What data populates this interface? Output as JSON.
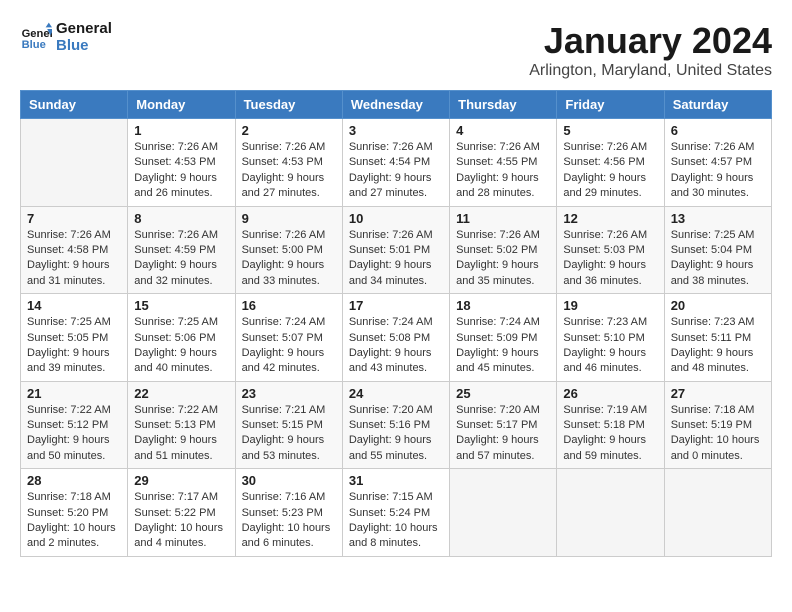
{
  "logo": {
    "line1": "General",
    "line2": "Blue"
  },
  "title": "January 2024",
  "subtitle": "Arlington, Maryland, United States",
  "headers": [
    "Sunday",
    "Monday",
    "Tuesday",
    "Wednesday",
    "Thursday",
    "Friday",
    "Saturday"
  ],
  "weeks": [
    [
      {
        "day": "",
        "info": ""
      },
      {
        "day": "1",
        "info": "Sunrise: 7:26 AM\nSunset: 4:53 PM\nDaylight: 9 hours\nand 26 minutes."
      },
      {
        "day": "2",
        "info": "Sunrise: 7:26 AM\nSunset: 4:53 PM\nDaylight: 9 hours\nand 27 minutes."
      },
      {
        "day": "3",
        "info": "Sunrise: 7:26 AM\nSunset: 4:54 PM\nDaylight: 9 hours\nand 27 minutes."
      },
      {
        "day": "4",
        "info": "Sunrise: 7:26 AM\nSunset: 4:55 PM\nDaylight: 9 hours\nand 28 minutes."
      },
      {
        "day": "5",
        "info": "Sunrise: 7:26 AM\nSunset: 4:56 PM\nDaylight: 9 hours\nand 29 minutes."
      },
      {
        "day": "6",
        "info": "Sunrise: 7:26 AM\nSunset: 4:57 PM\nDaylight: 9 hours\nand 30 minutes."
      }
    ],
    [
      {
        "day": "7",
        "info": "Sunrise: 7:26 AM\nSunset: 4:58 PM\nDaylight: 9 hours\nand 31 minutes."
      },
      {
        "day": "8",
        "info": "Sunrise: 7:26 AM\nSunset: 4:59 PM\nDaylight: 9 hours\nand 32 minutes."
      },
      {
        "day": "9",
        "info": "Sunrise: 7:26 AM\nSunset: 5:00 PM\nDaylight: 9 hours\nand 33 minutes."
      },
      {
        "day": "10",
        "info": "Sunrise: 7:26 AM\nSunset: 5:01 PM\nDaylight: 9 hours\nand 34 minutes."
      },
      {
        "day": "11",
        "info": "Sunrise: 7:26 AM\nSunset: 5:02 PM\nDaylight: 9 hours\nand 35 minutes."
      },
      {
        "day": "12",
        "info": "Sunrise: 7:26 AM\nSunset: 5:03 PM\nDaylight: 9 hours\nand 36 minutes."
      },
      {
        "day": "13",
        "info": "Sunrise: 7:25 AM\nSunset: 5:04 PM\nDaylight: 9 hours\nand 38 minutes."
      }
    ],
    [
      {
        "day": "14",
        "info": "Sunrise: 7:25 AM\nSunset: 5:05 PM\nDaylight: 9 hours\nand 39 minutes."
      },
      {
        "day": "15",
        "info": "Sunrise: 7:25 AM\nSunset: 5:06 PM\nDaylight: 9 hours\nand 40 minutes."
      },
      {
        "day": "16",
        "info": "Sunrise: 7:24 AM\nSunset: 5:07 PM\nDaylight: 9 hours\nand 42 minutes."
      },
      {
        "day": "17",
        "info": "Sunrise: 7:24 AM\nSunset: 5:08 PM\nDaylight: 9 hours\nand 43 minutes."
      },
      {
        "day": "18",
        "info": "Sunrise: 7:24 AM\nSunset: 5:09 PM\nDaylight: 9 hours\nand 45 minutes."
      },
      {
        "day": "19",
        "info": "Sunrise: 7:23 AM\nSunset: 5:10 PM\nDaylight: 9 hours\nand 46 minutes."
      },
      {
        "day": "20",
        "info": "Sunrise: 7:23 AM\nSunset: 5:11 PM\nDaylight: 9 hours\nand 48 minutes."
      }
    ],
    [
      {
        "day": "21",
        "info": "Sunrise: 7:22 AM\nSunset: 5:12 PM\nDaylight: 9 hours\nand 50 minutes."
      },
      {
        "day": "22",
        "info": "Sunrise: 7:22 AM\nSunset: 5:13 PM\nDaylight: 9 hours\nand 51 minutes."
      },
      {
        "day": "23",
        "info": "Sunrise: 7:21 AM\nSunset: 5:15 PM\nDaylight: 9 hours\nand 53 minutes."
      },
      {
        "day": "24",
        "info": "Sunrise: 7:20 AM\nSunset: 5:16 PM\nDaylight: 9 hours\nand 55 minutes."
      },
      {
        "day": "25",
        "info": "Sunrise: 7:20 AM\nSunset: 5:17 PM\nDaylight: 9 hours\nand 57 minutes."
      },
      {
        "day": "26",
        "info": "Sunrise: 7:19 AM\nSunset: 5:18 PM\nDaylight: 9 hours\nand 59 minutes."
      },
      {
        "day": "27",
        "info": "Sunrise: 7:18 AM\nSunset: 5:19 PM\nDaylight: 10 hours\nand 0 minutes."
      }
    ],
    [
      {
        "day": "28",
        "info": "Sunrise: 7:18 AM\nSunset: 5:20 PM\nDaylight: 10 hours\nand 2 minutes."
      },
      {
        "day": "29",
        "info": "Sunrise: 7:17 AM\nSunset: 5:22 PM\nDaylight: 10 hours\nand 4 minutes."
      },
      {
        "day": "30",
        "info": "Sunrise: 7:16 AM\nSunset: 5:23 PM\nDaylight: 10 hours\nand 6 minutes."
      },
      {
        "day": "31",
        "info": "Sunrise: 7:15 AM\nSunset: 5:24 PM\nDaylight: 10 hours\nand 8 minutes."
      },
      {
        "day": "",
        "info": ""
      },
      {
        "day": "",
        "info": ""
      },
      {
        "day": "",
        "info": ""
      }
    ]
  ]
}
